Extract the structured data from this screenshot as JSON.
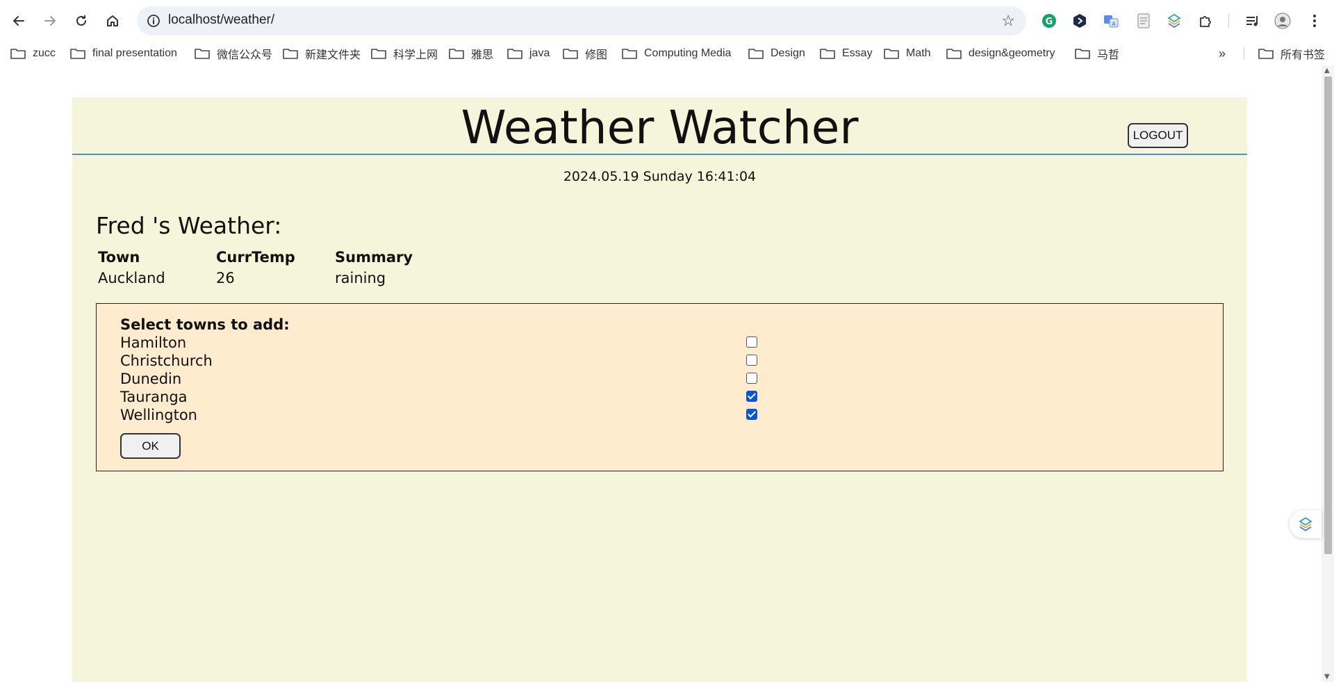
{
  "browser": {
    "url": "localhost/weather/",
    "bookmarks": [
      {
        "label": "zucc"
      },
      {
        "label": "final presentation"
      },
      {
        "label": "微信公众号"
      },
      {
        "label": "新建文件夹"
      },
      {
        "label": "科学上网"
      },
      {
        "label": "雅思"
      },
      {
        "label": "java"
      },
      {
        "label": "修图"
      },
      {
        "label": "Computing Media"
      },
      {
        "label": "Design"
      },
      {
        "label": "Essay"
      },
      {
        "label": "Math"
      },
      {
        "label": "design&geometry"
      },
      {
        "label": "马哲"
      }
    ],
    "all_bookmarks_label": "所有书签",
    "extensions": [
      "grammarly-icon",
      "extension-hex-icon",
      "translate-icon",
      "document-icon",
      "layers-icon",
      "puzzle-icon"
    ]
  },
  "page": {
    "title": "Weather Watcher",
    "logout_label": "LOGOUT",
    "datetime": "2024.05.19 Sunday 16:41:04",
    "greeting": "Fred 's Weather:",
    "table": {
      "headers": [
        "Town",
        "CurrTemp",
        "Summary"
      ],
      "rows": [
        [
          "Auckland",
          "26",
          "raining"
        ]
      ]
    },
    "add_panel": {
      "title": "Select towns to add:",
      "towns": [
        {
          "name": "Hamilton",
          "checked": false
        },
        {
          "name": "Christchurch",
          "checked": false
        },
        {
          "name": "Dunedin",
          "checked": false
        },
        {
          "name": "Tauranga",
          "checked": true
        },
        {
          "name": "Wellington",
          "checked": true
        }
      ],
      "ok_label": "OK"
    }
  },
  "colors": {
    "page_bg": "#f5f5dc",
    "panel_bg": "#ffebcd",
    "header_rule": "#4a8fd8",
    "checkbox_checked": "#0b57d0"
  }
}
